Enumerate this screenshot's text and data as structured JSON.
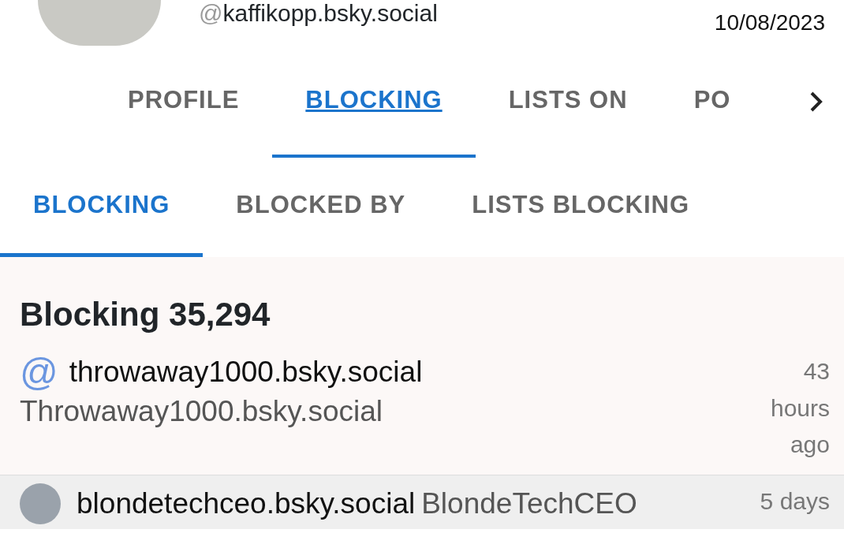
{
  "profile": {
    "handle_prefix": "@",
    "handle": "kaffikopp.bsky.social",
    "date": "10/08/2023"
  },
  "tabs": [
    {
      "label": "PROFILE",
      "selected": false
    },
    {
      "label": "BLOCKING",
      "selected": true
    },
    {
      "label": "LISTS ON",
      "selected": false
    },
    {
      "label": "PO",
      "selected": false
    }
  ],
  "subtabs": [
    {
      "label": "BLOCKING",
      "selected": true
    },
    {
      "label": "BLOCKED BY",
      "selected": false
    },
    {
      "label": "LISTS BLOCKING",
      "selected": false
    }
  ],
  "heading": "Blocking 35,294",
  "rows": [
    {
      "kind": "glyph",
      "glyph": "@",
      "handle": "throwaway1000.bsky.social",
      "name": "Throwaway1000.bsky.social",
      "time": "43 hours ago",
      "selected": false
    },
    {
      "kind": "photo",
      "handle": "blondetechceo.bsky.social",
      "name": "BlondeTechCEO",
      "time": "5 days",
      "selected": true
    }
  ]
}
